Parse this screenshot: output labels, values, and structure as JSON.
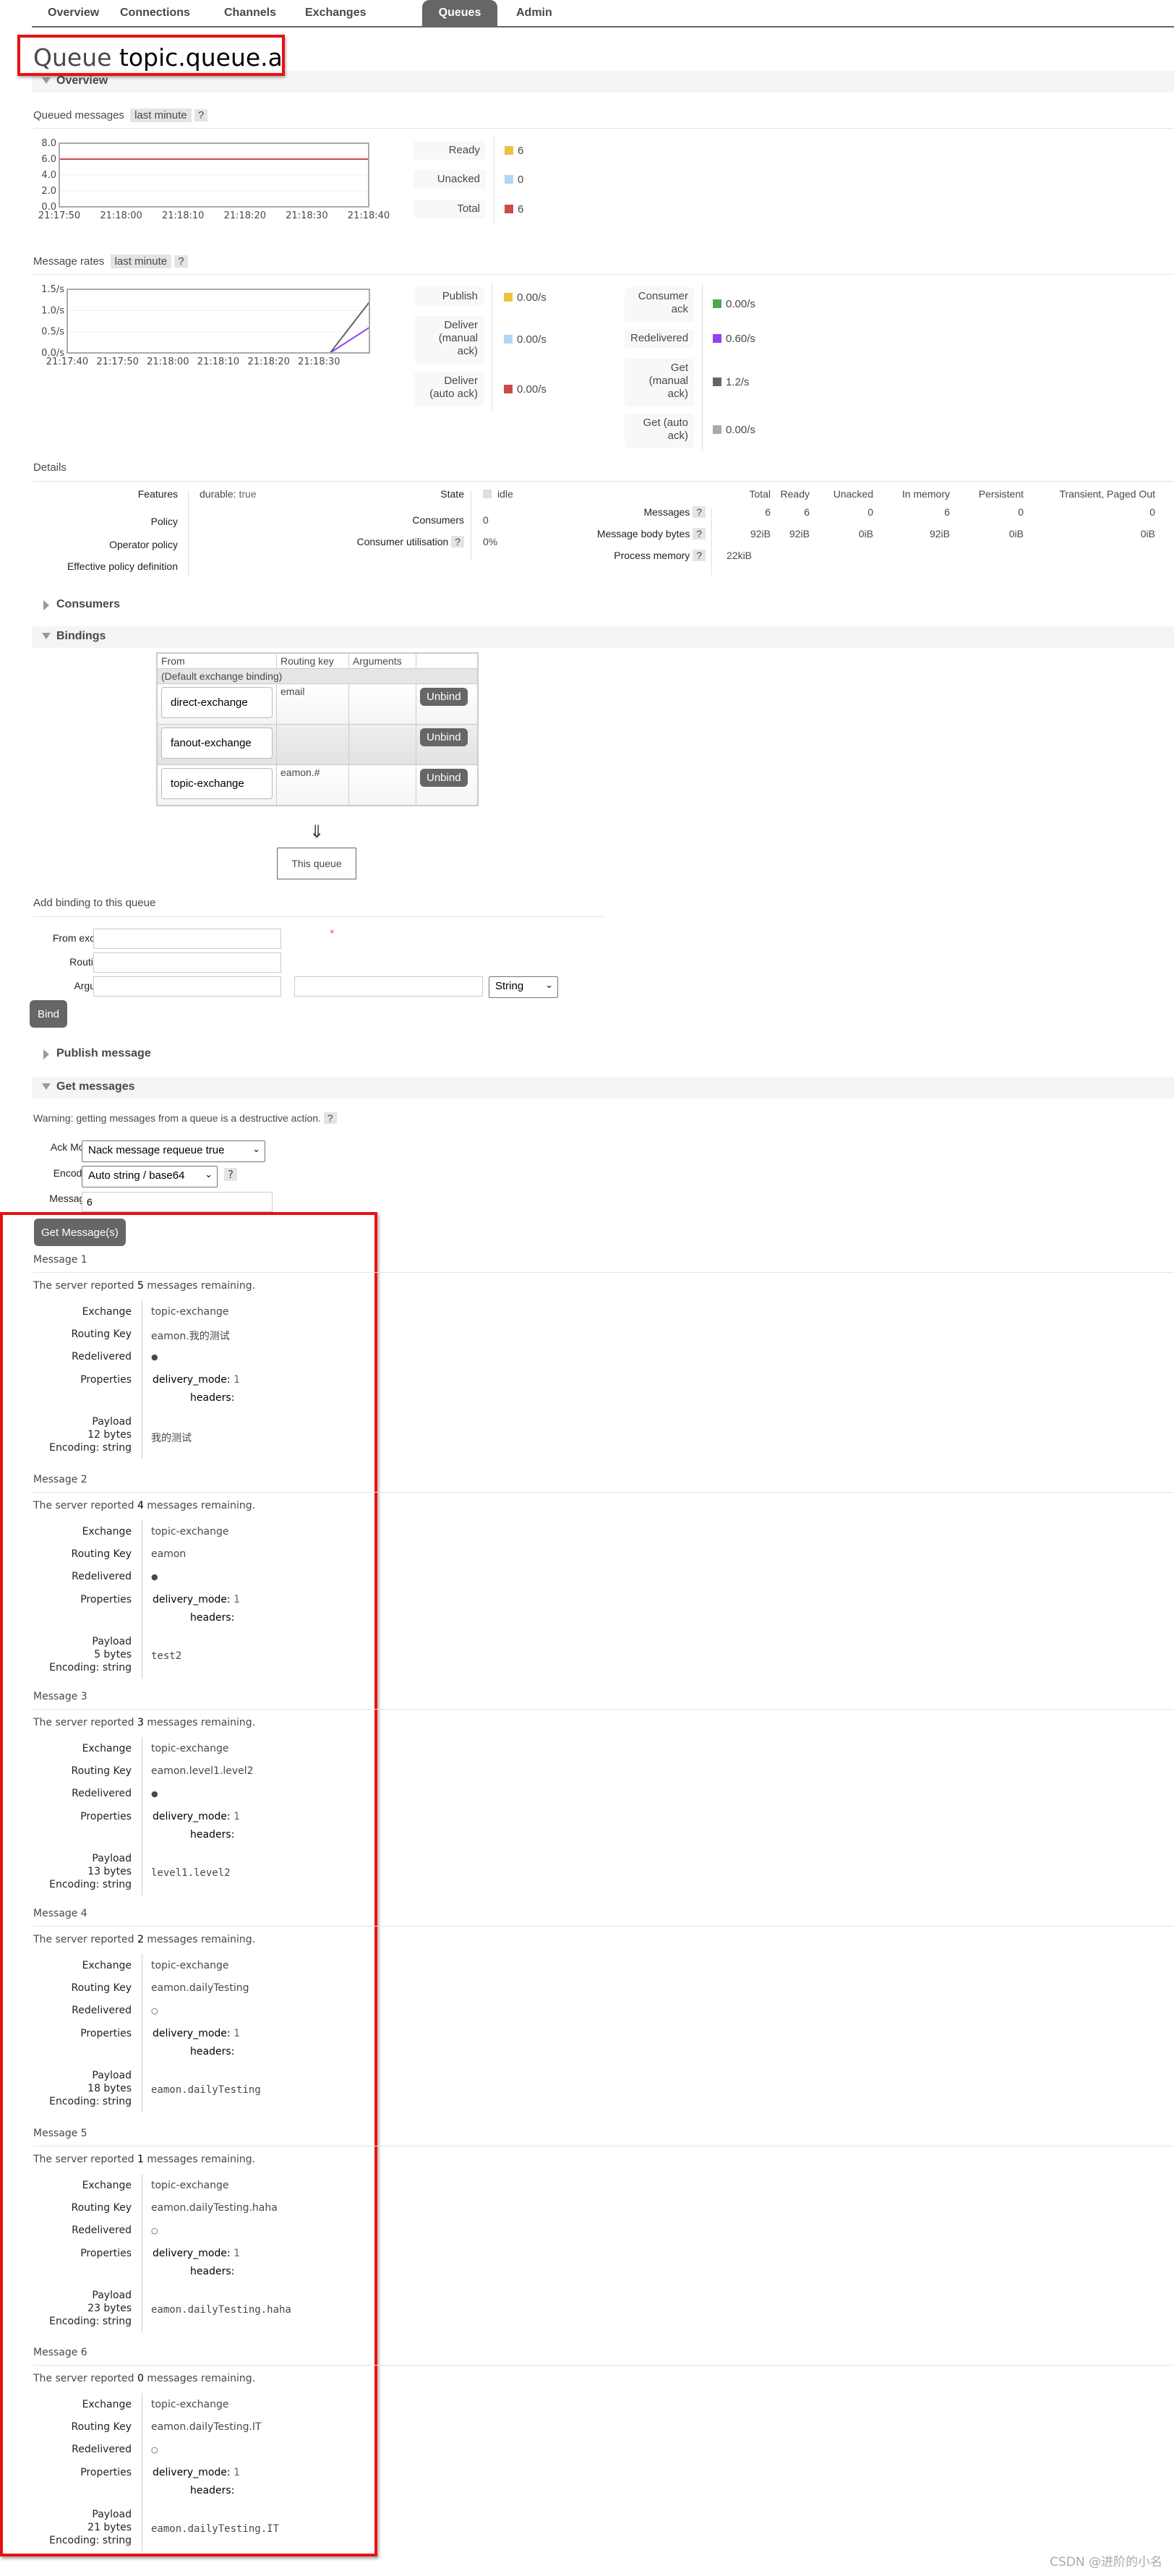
{
  "nav": {
    "tabs": [
      {
        "label": "Overview",
        "active": false
      },
      {
        "label": "Connections",
        "active": false
      },
      {
        "label": "Channels",
        "active": false
      },
      {
        "label": "Exchanges",
        "active": false
      },
      {
        "label": "Queues",
        "active": true
      },
      {
        "label": "Admin",
        "active": false
      }
    ]
  },
  "page": {
    "title_prefix": "Queue",
    "queue_name": "topic.queue.a"
  },
  "sections": {
    "overview": "Overview",
    "consumers": "Consumers",
    "bindings": "Bindings",
    "publish_message": "Publish message",
    "get_messages": "Get messages"
  },
  "queued_messages": {
    "heading": "Queued messages",
    "range": "last minute",
    "help": "?",
    "legend": [
      {
        "label": "Ready",
        "value": "6",
        "color": "#edc240"
      },
      {
        "label": "Unacked",
        "value": "0",
        "color": "#afd8f8"
      },
      {
        "label": "Total",
        "value": "6",
        "color": "#cb4b4b"
      }
    ]
  },
  "message_rates": {
    "heading": "Message rates",
    "range": "last minute",
    "help": "?",
    "legend_left": [
      {
        "label": "Publish",
        "value": "0.00/s",
        "color": "#edc240"
      },
      {
        "label": "Deliver (manual ack)",
        "value": "0.00/s",
        "color": "#afd8f8"
      },
      {
        "label": "Deliver (auto ack)",
        "value": "0.00/s",
        "color": "#cb4b4b"
      }
    ],
    "legend_right": [
      {
        "label": "Consumer ack",
        "value": "0.00/s",
        "color": "#4da74d"
      },
      {
        "label": "Redelivered",
        "value": "0.60/s",
        "color": "#9440ed"
      },
      {
        "label": "Get (manual ack)",
        "value": "1.2/s",
        "color": "#666666"
      },
      {
        "label": "Get (auto ack)",
        "value": "0.00/s",
        "color": "#aaaaaa"
      }
    ]
  },
  "chart_data": [
    {
      "type": "line",
      "title": "Queued messages (last minute)",
      "x": [
        "21:17:50",
        "21:18:00",
        "21:18:10",
        "21:18:20",
        "21:18:30",
        "21:18:40"
      ],
      "yticks": [
        "0.0",
        "2.0",
        "4.0",
        "6.0",
        "8.0"
      ],
      "ylim": [
        0,
        8
      ],
      "grid": true,
      "series": [
        {
          "name": "Total",
          "color": "#cb4b4b",
          "values": [
            6,
            6,
            6,
            6,
            6,
            6
          ]
        },
        {
          "name": "Ready",
          "color": "#edc240",
          "values": [
            6,
            6,
            6,
            6,
            6,
            6
          ]
        },
        {
          "name": "Unacked",
          "color": "#afd8f8",
          "values": [
            0,
            0,
            0,
            0,
            0,
            0
          ]
        }
      ]
    },
    {
      "type": "line",
      "title": "Message rates (last minute)",
      "x": [
        "21:17:40",
        "21:17:50",
        "21:18:00",
        "21:18:10",
        "21:18:20",
        "21:18:30",
        "21:18:35"
      ],
      "xticks": [
        "21:17:40",
        "21:17:50",
        "21:18:00",
        "21:18:10",
        "21:18:20",
        "21:18:30"
      ],
      "yticks": [
        "0.0/s",
        "0.5/s",
        "1.0/s",
        "1.5/s"
      ],
      "ylim": [
        0,
        1.5
      ],
      "grid": true,
      "series": [
        {
          "name": "Get (manual ack)",
          "color": "#666666",
          "values": [
            0,
            0,
            0,
            0,
            0,
            0,
            1.2
          ]
        },
        {
          "name": "Redelivered",
          "color": "#9440ed",
          "values": [
            0,
            0,
            0,
            0,
            0,
            0,
            0.6
          ]
        },
        {
          "name": "Publish",
          "color": "#edc240",
          "values": [
            0,
            0,
            0,
            0,
            0,
            0,
            0
          ]
        }
      ]
    }
  ],
  "details": {
    "heading": "Details",
    "features_label": "Features",
    "features_key": "durable:",
    "features_value": "true",
    "policy_label": "Policy",
    "operator_policy_label": "Operator policy",
    "effective_policy_label": "Effective policy definition",
    "state_label": "State",
    "state_value": "idle",
    "consumers_label": "Consumers",
    "consumers_value": "0",
    "consumer_util_label": "Consumer utilisation",
    "consumer_util_value": "0%",
    "stats": {
      "columns": [
        "Total",
        "Ready",
        "Unacked",
        "In memory",
        "Persistent",
        "Transient, Paged Out"
      ],
      "rows": [
        {
          "label": "Messages",
          "values": [
            "6",
            "6",
            "0",
            "6",
            "0",
            "0"
          ]
        },
        {
          "label": "Message body bytes",
          "values": [
            "92iB",
            "92iB",
            "0iB",
            "92iB",
            "0iB",
            "0iB"
          ]
        },
        {
          "label": "Process memory",
          "values": [
            "22kiB"
          ]
        }
      ]
    }
  },
  "bindings": {
    "columns": [
      "From",
      "Routing key",
      "Arguments",
      ""
    ],
    "default_row": "(Default exchange binding)",
    "rows": [
      {
        "from": "direct-exchange",
        "routing_key": "email",
        "arguments": "",
        "action": "Unbind"
      },
      {
        "from": "fanout-exchange",
        "routing_key": "",
        "arguments": "",
        "action": "Unbind"
      },
      {
        "from": "topic-exchange",
        "routing_key": "eamon.#",
        "arguments": "",
        "action": "Unbind"
      }
    ],
    "arrow": "⇓",
    "this_queue": "This queue"
  },
  "add_binding": {
    "heading": "Add binding to this queue",
    "from_label": "From exchange:",
    "from_value": "",
    "required_mark": "*",
    "routing_label": "Routing key:",
    "routing_value": "",
    "args_label": "Arguments:",
    "args_key": "",
    "args_eq": "=",
    "args_value": "",
    "args_type": "String",
    "bind_button": "Bind"
  },
  "get_messages": {
    "warning": "Warning: getting messages from a queue is a destructive action.",
    "ack_mode_label": "Ack Mode:",
    "ack_mode_value": "Nack message requeue true",
    "encoding_label": "Encoding:",
    "encoding_value": "Auto string / base64",
    "messages_label": "Messages:",
    "messages_value": "6",
    "button": "Get Message(s)"
  },
  "message_labels": {
    "exchange": "Exchange",
    "routing_key": "Routing Key",
    "redelivered": "Redelivered",
    "properties": "Properties",
    "payload": "Payload",
    "delivery_mode_key": "delivery_mode:",
    "headers_key": "headers:"
  },
  "messages": [
    {
      "title": "Message 1",
      "remaining_pre": "The server reported",
      "remaining": "5",
      "remaining_post": "messages remaining.",
      "exchange": "topic-exchange",
      "routing_key": "eamon.我的测试",
      "redelivered": "●",
      "delivery_mode": "1",
      "payload_bytes": "12 bytes",
      "encoding": "Encoding: string",
      "payload": "我的测试"
    },
    {
      "title": "Message 2",
      "remaining_pre": "The server reported",
      "remaining": "4",
      "remaining_post": "messages remaining.",
      "exchange": "topic-exchange",
      "routing_key": "eamon",
      "redelivered": "●",
      "delivery_mode": "1",
      "payload_bytes": "5 bytes",
      "encoding": "Encoding: string",
      "payload": "test2"
    },
    {
      "title": "Message 3",
      "remaining_pre": "The server reported",
      "remaining": "3",
      "remaining_post": "messages remaining.",
      "exchange": "topic-exchange",
      "routing_key": "eamon.level1.level2",
      "redelivered": "●",
      "delivery_mode": "1",
      "payload_bytes": "13 bytes",
      "encoding": "Encoding: string",
      "payload": "level1.level2"
    },
    {
      "title": "Message 4",
      "remaining_pre": "The server reported",
      "remaining": "2",
      "remaining_post": "messages remaining.",
      "exchange": "topic-exchange",
      "routing_key": "eamon.dailyTesting",
      "redelivered": "○",
      "delivery_mode": "1",
      "payload_bytes": "18 bytes",
      "encoding": "Encoding: string",
      "payload": "eamon.dailyTesting"
    },
    {
      "title": "Message 5",
      "remaining_pre": "The server reported",
      "remaining": "1",
      "remaining_post": "messages remaining.",
      "exchange": "topic-exchange",
      "routing_key": "eamon.dailyTesting.haha",
      "redelivered": "○",
      "delivery_mode": "1",
      "payload_bytes": "23 bytes",
      "encoding": "Encoding: string",
      "payload": "eamon.dailyTesting.haha"
    },
    {
      "title": "Message 6",
      "remaining_pre": "The server reported",
      "remaining": "0",
      "remaining_post": "messages remaining.",
      "exchange": "topic-exchange",
      "routing_key": "eamon.dailyTesting.IT",
      "redelivered": "○",
      "delivery_mode": "1",
      "payload_bytes": "21 bytes",
      "encoding": "Encoding: string",
      "payload": "eamon.dailyTesting.IT"
    }
  ],
  "watermark": "CSDN @进阶的小名"
}
